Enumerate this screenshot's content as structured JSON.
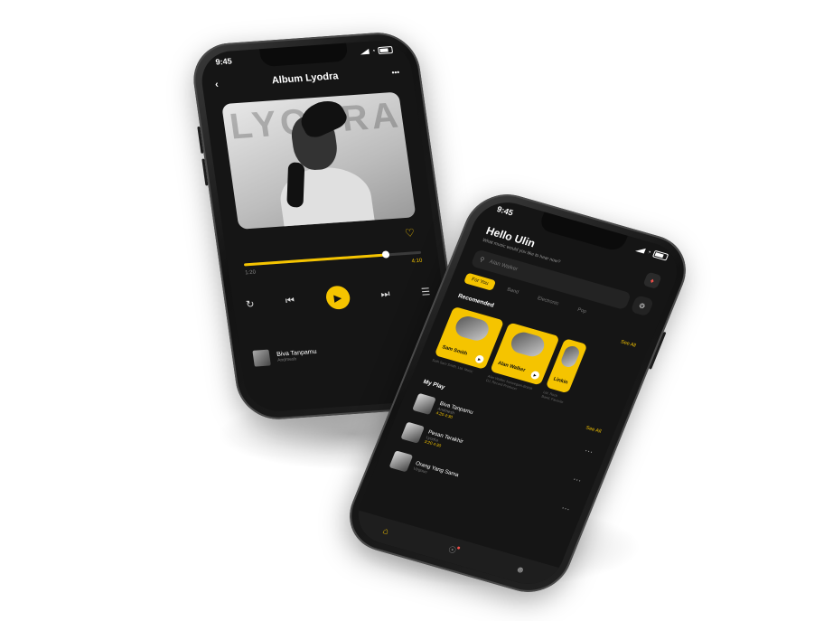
{
  "player": {
    "time": "9:45",
    "back_icon": "back-icon",
    "title": "Album Lyodra",
    "more": "•••",
    "cover_watermark": "LYODRA",
    "progress_fraction": 0.8,
    "elapsed": "1:20",
    "total": "4:10",
    "now_playing": {
      "title": "Biva Tanpamu",
      "artist": "Andmesh",
      "more": "..."
    }
  },
  "home": {
    "time": "9:45",
    "greeting": "Hello Ulin",
    "subtitle": "What music would you like to hear now?",
    "search_placeholder": "Alan Walker",
    "tabs": [
      {
        "label": "For You",
        "active": true
      },
      {
        "label": "Band",
        "active": false
      },
      {
        "label": "Electronic",
        "active": false
      },
      {
        "label": "Pop",
        "active": false
      }
    ],
    "recommended": {
      "title": "Recomended",
      "see_all": "See All",
      "cards": [
        {
          "name": "Sam Smith",
          "desc": "Seth Sam Smith, Ltd. Music"
        },
        {
          "name": "Alan Walker",
          "desc": "Alan Walker Norwegian-British DJ, Record Producer"
        },
        {
          "name": "Linkin",
          "desc": "Ltd. Rock Band, Favorite"
        }
      ]
    },
    "playlist": {
      "title": "My Play",
      "see_all": "See All",
      "tracks": [
        {
          "title": "Biva Tanpamu",
          "artist": "Andmesh",
          "duration": "4:20 4:30"
        },
        {
          "title": "Pesan Terakhir",
          "artist": "Lyodra",
          "duration": "3:20 4:30"
        },
        {
          "title": "Orang Yang Sama",
          "artist": "Virgoun",
          "duration": ""
        }
      ]
    },
    "nav": [
      "home-icon",
      "explore-icon",
      "profile-icon"
    ]
  },
  "colors": {
    "accent": "#f5c400",
    "background": "#151515",
    "alert": "#f0504a"
  }
}
